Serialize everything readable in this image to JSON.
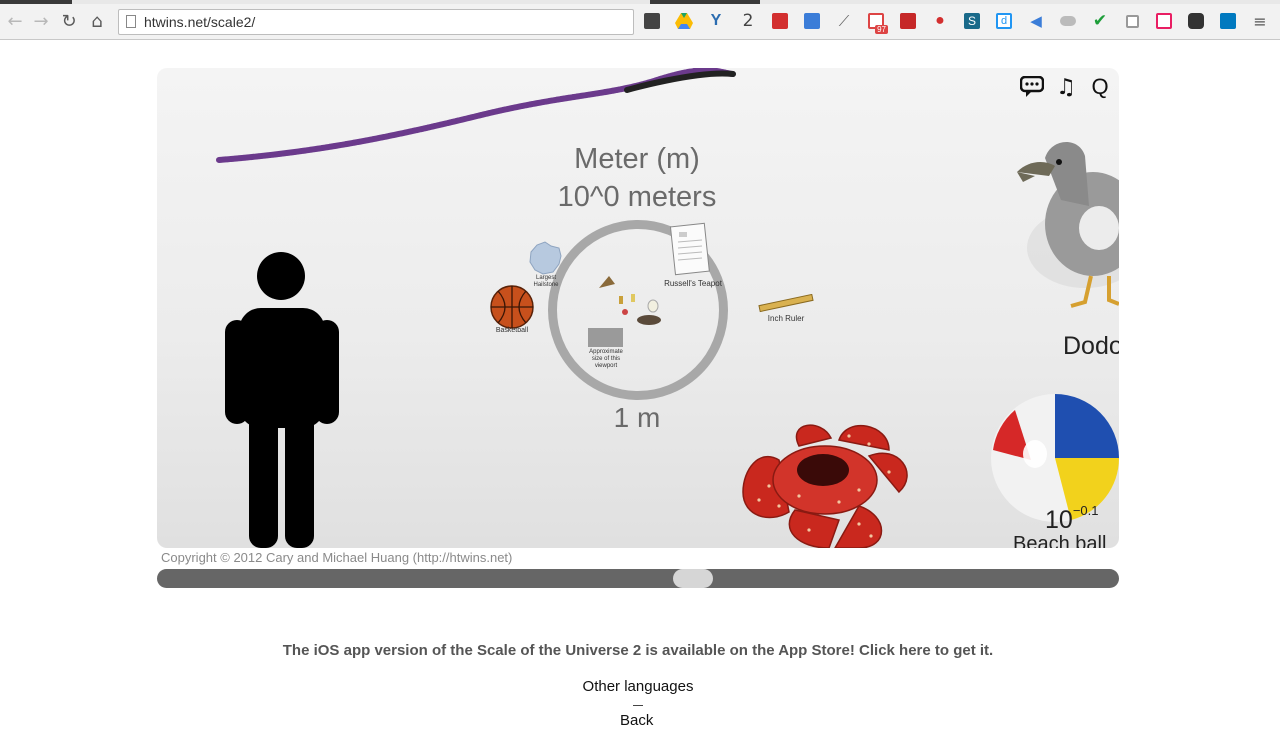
{
  "browser": {
    "url": "htwins.net/scale2/",
    "extension_badges": {
      "counter": "2",
      "gmail_count": "97"
    }
  },
  "viewport": {
    "title_unit": "Meter (m)",
    "title_power": "10^0 meters",
    "scale_label": "1 m",
    "objects": {
      "largest_hailstone": "Largest Hailstone",
      "basketball": "Basketball",
      "russells_teapot": "Russell's Teapot",
      "inch_ruler": "Inch Ruler",
      "viewport_size": "Approximate size of this viewport",
      "dodo": "Dodo",
      "beach_ball_exp_base": "10",
      "beach_ball_exp": "−0.1",
      "beach_ball": "Beach ball"
    }
  },
  "copyright": "Copyright © 2012 Cary and Michael Huang (http://htwins.net)",
  "slider": {
    "position": 0.56
  },
  "ios_note": "The iOS app version of the Scale of the Universe 2 is available on the App Store! Click here to get it.",
  "other_languages": "Other languages",
  "next_language_fragment": "Back",
  "colors": {
    "slider_track": "#666666",
    "slider_thumb": "#d6d6d6",
    "circle": "#a8a8a8"
  }
}
